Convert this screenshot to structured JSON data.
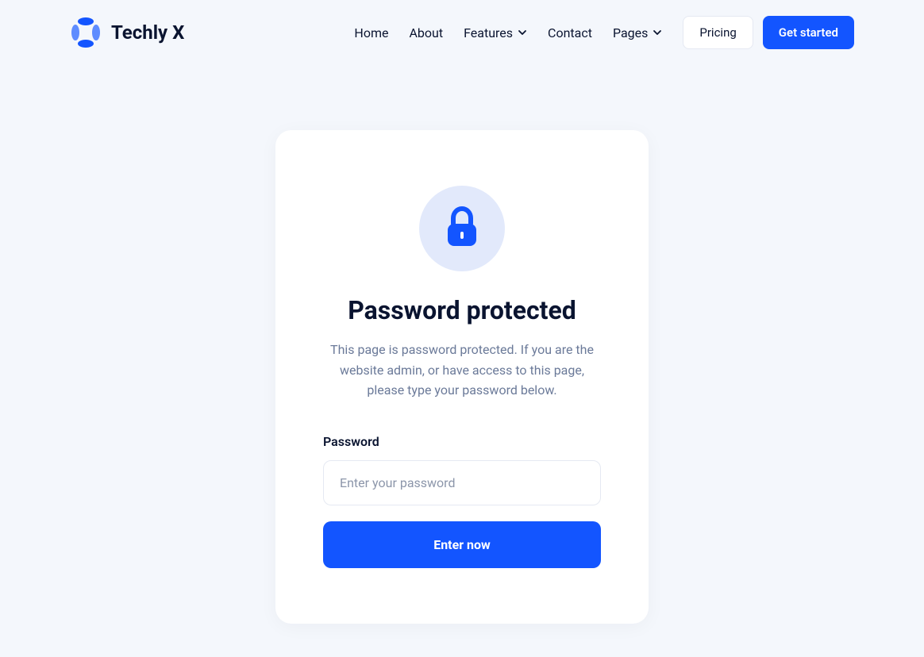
{
  "brand": {
    "name": "Techly X"
  },
  "nav": {
    "items": [
      {
        "label": "Home",
        "has_dropdown": false
      },
      {
        "label": "About",
        "has_dropdown": false
      },
      {
        "label": "Features",
        "has_dropdown": true
      },
      {
        "label": "Contact",
        "has_dropdown": false
      },
      {
        "label": "Pages",
        "has_dropdown": true
      }
    ]
  },
  "header_buttons": {
    "secondary": "Pricing",
    "primary": "Get started"
  },
  "card": {
    "title": "Password protected",
    "description": "This page is password protected. If you are the website admin, or have access to this page, please type your password below.",
    "field_label": "Password",
    "placeholder": "Enter your password",
    "submit_label": "Enter now"
  },
  "colors": {
    "accent": "#1355ff",
    "background": "#f4f7fc",
    "text_primary": "#0a1430",
    "text_secondary": "#6b7a99"
  }
}
